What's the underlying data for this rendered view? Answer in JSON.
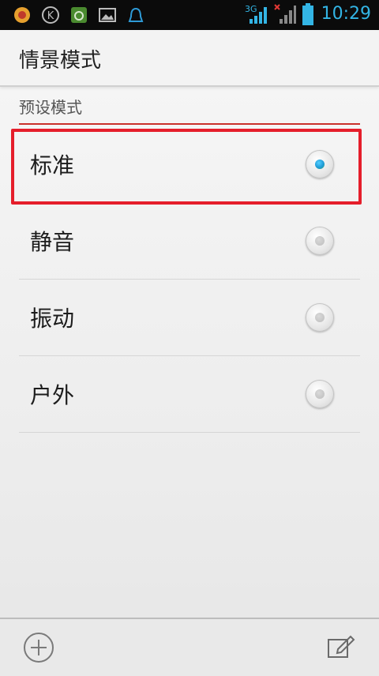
{
  "status_bar": {
    "time": "10:29",
    "network_label": "3G",
    "icons": [
      "ucweb-icon",
      "k-app-icon",
      "security-icon",
      "gallery-icon",
      "qq-icon",
      "signal-icon",
      "no-signal-icon",
      "battery-icon"
    ],
    "time_color": "#33b5e5"
  },
  "action_bar": {
    "title": "情景模式"
  },
  "section": {
    "title": "预设模式"
  },
  "profiles": [
    {
      "label": "标准",
      "selected": true
    },
    {
      "label": "静音",
      "selected": false
    },
    {
      "label": "振动",
      "selected": false
    },
    {
      "label": "户外",
      "selected": false
    }
  ],
  "bottom_bar": {
    "icons": [
      "add-icon",
      "edit-icon"
    ]
  },
  "colors": {
    "accent": "#e51e2b",
    "radio_selected": "#1f9bd8"
  }
}
